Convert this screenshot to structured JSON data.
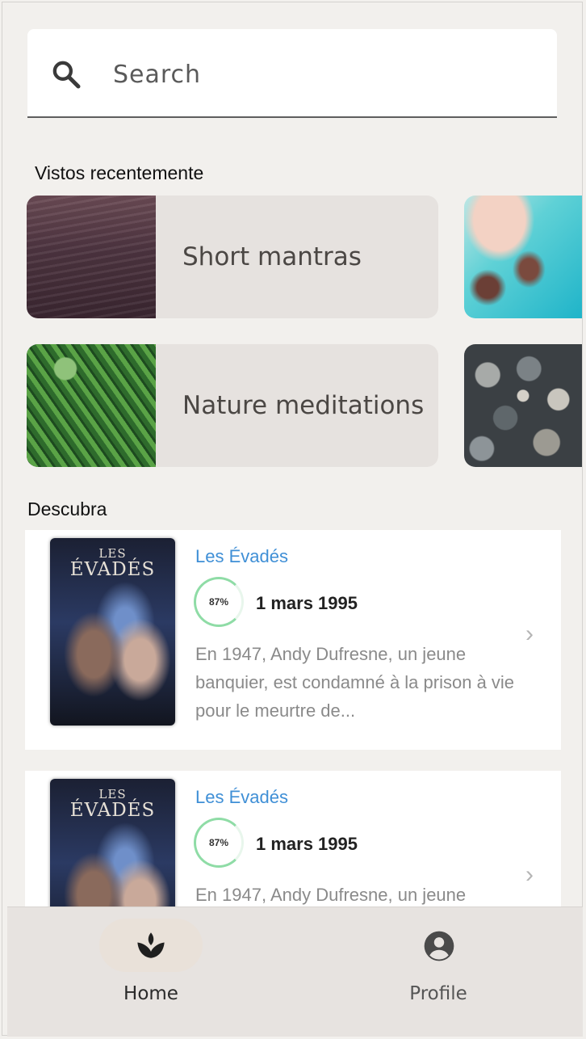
{
  "search": {
    "placeholder": "Search"
  },
  "recent": {
    "title": "Vistos recentemente",
    "items": [
      {
        "label": "Short mantras"
      },
      {
        "label": "Nature meditations"
      }
    ]
  },
  "discover": {
    "title": "Descubra",
    "items": [
      {
        "poster_line1": "LES",
        "poster_line2": "ÉVADÉS",
        "title": "Les Évadés",
        "score": "87%",
        "date": "1 mars 1995",
        "description": "En 1947, Andy Dufresne, un jeune banquier, est condamné à la prison à vie pour le meurtre de..."
      },
      {
        "poster_line1": "LES",
        "poster_line2": "ÉVADÉS",
        "title": "Les Évadés",
        "score": "87%",
        "date": "1 mars 1995",
        "description": "En 1947, Andy Dufresne, un jeune"
      }
    ]
  },
  "nav": {
    "home": "Home",
    "profile": "Profile"
  },
  "colors": {
    "background": "#f2f0ed",
    "card": "#e6e2df",
    "link_blue": "#3f8fd6",
    "score_green": "#8fdca6"
  }
}
